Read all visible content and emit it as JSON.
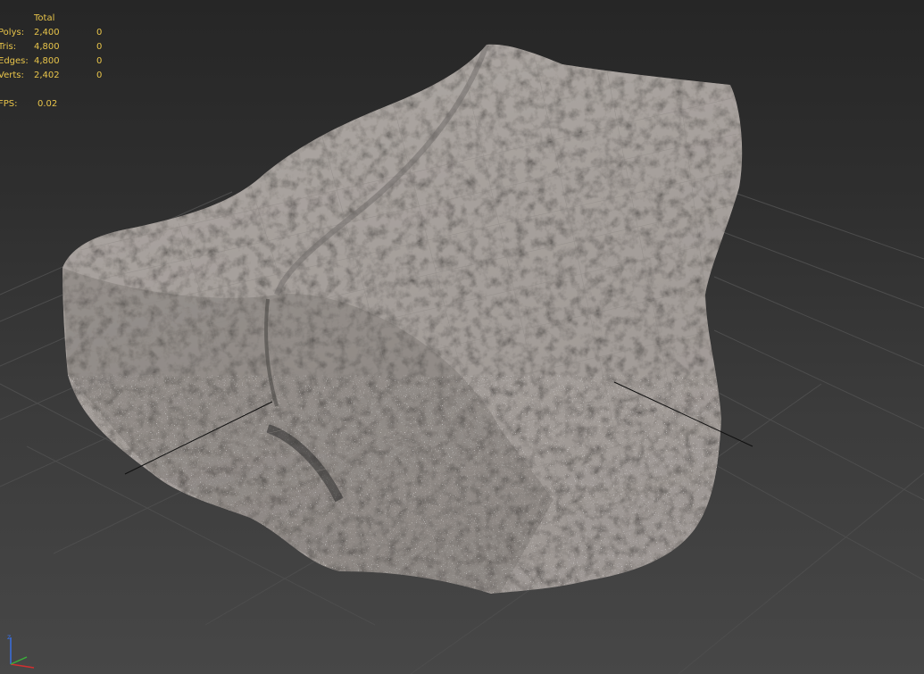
{
  "viewport": {
    "background": "#3a3a3a",
    "grid_color": "#4d4d4d",
    "mesh_color": "#a8a29e"
  },
  "stats": {
    "header": "Total",
    "rows": [
      {
        "label": "Polys:",
        "total": "2,400",
        "selected": "0"
      },
      {
        "label": "Tris:",
        "total": "4,800",
        "selected": "0"
      },
      {
        "label": "Edges:",
        "total": "4,800",
        "selected": "0"
      },
      {
        "label": "Verts:",
        "total": "2,402",
        "selected": "0"
      }
    ],
    "fps_label": "FPS:",
    "fps_value": "0.02",
    "color": "#e8c44a"
  },
  "gizmo": {
    "axes": [
      {
        "name": "z",
        "color": "#3a6fe0"
      },
      {
        "name": "x",
        "color": "#d03030"
      },
      {
        "name": "y",
        "color": "#3ab03a"
      }
    ]
  }
}
